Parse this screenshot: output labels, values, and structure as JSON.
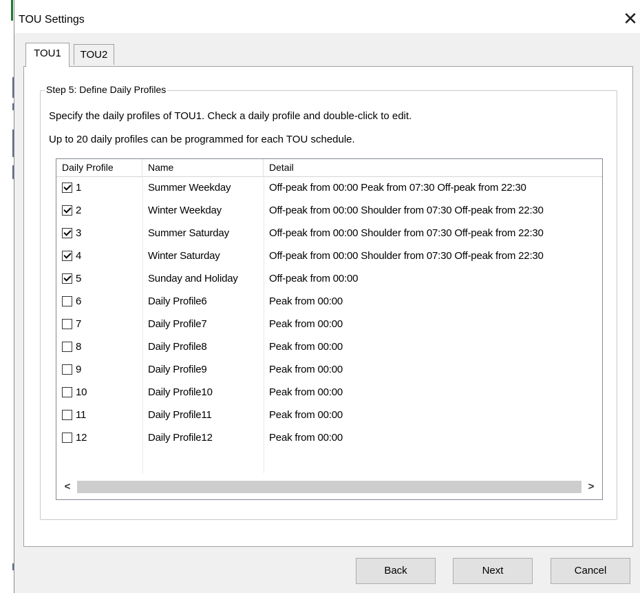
{
  "window": {
    "title": "TOU Settings",
    "close_symbol": "✕"
  },
  "tabs": [
    {
      "label": "TOU1",
      "active": true
    },
    {
      "label": "TOU2",
      "active": false
    }
  ],
  "group": {
    "legend": "Step 5: Define Daily Profiles",
    "instruction_1": "Specify the daily profiles of TOU1. Check a daily profile and double-click to edit.",
    "instruction_2": "Up to 20 daily profiles can be programmed for each TOU schedule."
  },
  "table": {
    "columns": [
      "Daily Profile",
      "Name",
      "Detail"
    ],
    "rows": [
      {
        "num": "1",
        "checked": true,
        "name": "Summer Weekday",
        "detail": "Off-peak from 00:00 Peak from 07:30 Off-peak from 22:30"
      },
      {
        "num": "2",
        "checked": true,
        "name": "Winter Weekday",
        "detail": "Off-peak from 00:00 Shoulder from 07:30 Off-peak from 22:30"
      },
      {
        "num": "3",
        "checked": true,
        "name": "Summer Saturday",
        "detail": "Off-peak from 00:00 Shoulder from 07:30 Off-peak from 22:30"
      },
      {
        "num": "4",
        "checked": true,
        "name": "Winter Saturday",
        "detail": "Off-peak from 00:00 Shoulder from 07:30 Off-peak from 22:30"
      },
      {
        "num": "5",
        "checked": true,
        "name": "Sunday and Holiday",
        "detail": "Off-peak from 00:00"
      },
      {
        "num": "6",
        "checked": false,
        "name": "Daily Profile6",
        "detail": "Peak from 00:00"
      },
      {
        "num": "7",
        "checked": false,
        "name": "Daily Profile7",
        "detail": "Peak from 00:00"
      },
      {
        "num": "8",
        "checked": false,
        "name": "Daily Profile8",
        "detail": "Peak from 00:00"
      },
      {
        "num": "9",
        "checked": false,
        "name": "Daily Profile9",
        "detail": "Peak from 00:00"
      },
      {
        "num": "10",
        "checked": false,
        "name": "Daily Profile10",
        "detail": "Peak from 00:00"
      },
      {
        "num": "11",
        "checked": false,
        "name": "Daily Profile11",
        "detail": "Peak from 00:00"
      },
      {
        "num": "12",
        "checked": false,
        "name": "Daily Profile12",
        "detail": "Peak from 00:00"
      }
    ]
  },
  "scrollbar": {
    "left_symbol": "<",
    "right_symbol": ">"
  },
  "buttons": {
    "back": "Back",
    "next": "Next",
    "cancel": "Cancel"
  }
}
